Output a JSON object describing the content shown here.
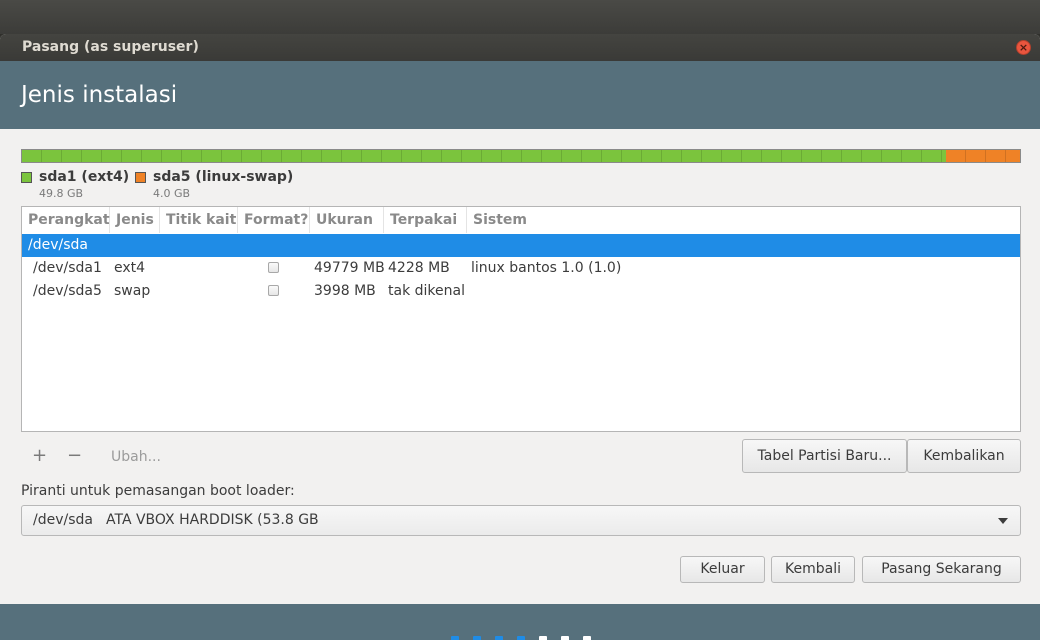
{
  "window": {
    "title": "Pasang (as superuser)",
    "close_glyph": "×"
  },
  "page": {
    "title": "Jenis instalasi"
  },
  "partition_bar": {
    "segments": [
      {
        "name": "sda1 (ext4)",
        "size": "49.8 GB",
        "color": "#7bc43d"
      },
      {
        "name": "sda5 (linux-swap)",
        "size": "4.0 GB",
        "color": "#ef8226"
      }
    ]
  },
  "table": {
    "columns": [
      "Perangkat",
      "Jenis",
      "Titik kait",
      "Format?",
      "Ukuran",
      "Terpakai",
      "Sistem"
    ],
    "rows": [
      {
        "device": "/dev/sda",
        "type": "",
        "mount": "",
        "format": false,
        "size": "",
        "used": "",
        "system": "",
        "selected": true
      },
      {
        "device": "/dev/sda1",
        "type": "ext4",
        "mount": "",
        "format": false,
        "size": "49779 MB",
        "used": "4228 MB",
        "system": "linux bantos 1.0 (1.0)",
        "selected": false
      },
      {
        "device": "/dev/sda5",
        "type": "swap",
        "mount": "",
        "format": false,
        "size": "3998 MB",
        "used": "tak dikenal",
        "system": "",
        "selected": false
      }
    ]
  },
  "toolbar": {
    "add": "+",
    "remove": "−",
    "edit": "Ubah...",
    "new_table": "Tabel Partisi Baru...",
    "revert": "Kembalikan"
  },
  "bootloader": {
    "label": "Piranti untuk pemasangan boot loader:",
    "device": "/dev/sda",
    "model": "ATA VBOX HARDDISK (53.8 GB"
  },
  "actions": {
    "quit": "Keluar",
    "back": "Kembali",
    "install": "Pasang Sekarang"
  },
  "progress": {
    "steps_total": 7,
    "steps_done": 4,
    "done_color": "#1f8ce6",
    "todo_color": "#ffffff"
  },
  "colors": {
    "header": "#56707c",
    "selection": "#1f8ce6",
    "close": "#e9553e"
  }
}
